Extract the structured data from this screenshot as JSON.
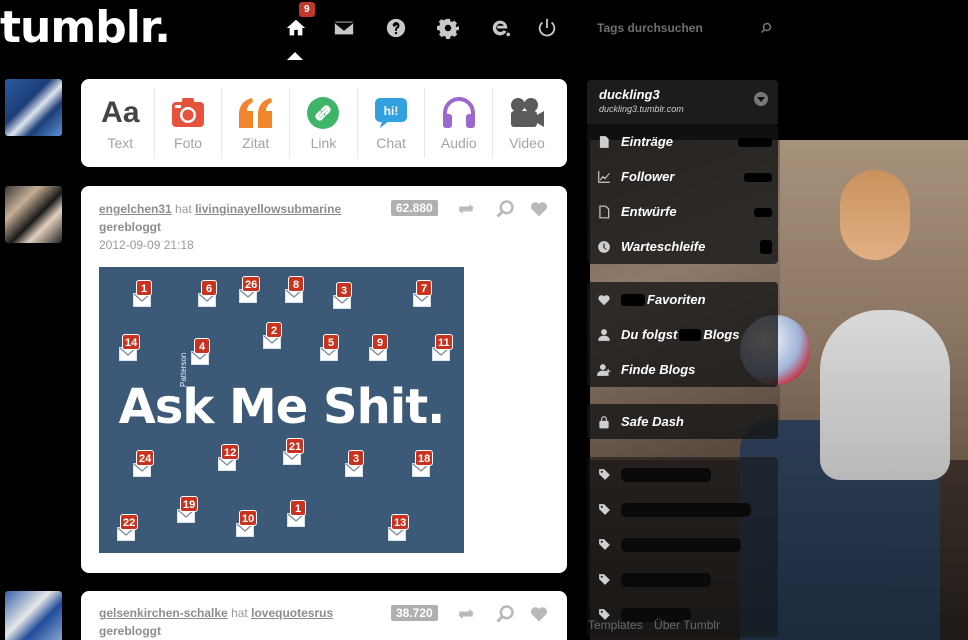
{
  "header": {
    "logo": "tumblr.",
    "home_badge": "9",
    "search_placeholder": "Tags durchsuchen"
  },
  "post_types": [
    {
      "label": "Text",
      "icon": "text-icon"
    },
    {
      "label": "Foto",
      "icon": "camera-icon"
    },
    {
      "label": "Zitat",
      "icon": "quote-icon"
    },
    {
      "label": "Link",
      "icon": "link-icon"
    },
    {
      "label": "Chat",
      "icon": "chat-icon"
    },
    {
      "label": "Audio",
      "icon": "headphones-icon"
    },
    {
      "label": "Video",
      "icon": "video-camera-icon"
    }
  ],
  "text_icon_glyph": "Aa",
  "posts": [
    {
      "user": "engelchen31",
      "verb": "hat",
      "source": "livinginayellowsubmarine",
      "action": "gerebloggt",
      "date": "2012-09-09 21:18",
      "notes": "62.880",
      "image": {
        "title": "Ask Me Shit.",
        "watermark": "Patterson",
        "counts": [
          "1",
          "6",
          "26",
          "8",
          "3",
          "7",
          "14",
          "4",
          "2",
          "5",
          "9",
          "11",
          "24",
          "12",
          "21",
          "3",
          "18",
          "22",
          "19",
          "10",
          "1",
          "13"
        ]
      }
    },
    {
      "user": "gelsenkirchen-schalke",
      "verb": "hat",
      "source": "lovequotesrus",
      "action": "gerebloggt",
      "notes": "38.720"
    }
  ],
  "sidebar": {
    "blog_name": "duckling3",
    "blog_url": "duckling3.tumblr.com",
    "items": [
      {
        "label": "Einträge",
        "icon": "document-icon"
      },
      {
        "label": "Follower",
        "icon": "chart-icon"
      },
      {
        "label": "Entwürfe",
        "icon": "draft-icon"
      },
      {
        "label": "Warteschleife",
        "icon": "clock-icon"
      }
    ],
    "secondary": [
      {
        "label": "Favoriten",
        "icon": "heart-icon"
      },
      {
        "label": "Du folgst",
        "label_suffix": "Blogs",
        "icon": "person-icon"
      },
      {
        "label": "Finde Blogs",
        "icon": "add-person-icon"
      }
    ],
    "safe_dash": {
      "label": "Safe Dash",
      "icon": "lock-icon"
    }
  },
  "footer": {
    "links": [
      "Templates",
      "Über Tumblr"
    ]
  },
  "colors": {
    "badge_red": "#c0392b",
    "envelope_badge": "#c8321f",
    "ask_bg": "#3c5a78",
    "foto": "#e5533d",
    "zitat": "#f1852c",
    "link": "#3fb56a",
    "chat": "#33a0e0",
    "audio": "#9b68d0",
    "video": "#5b5b5b"
  }
}
